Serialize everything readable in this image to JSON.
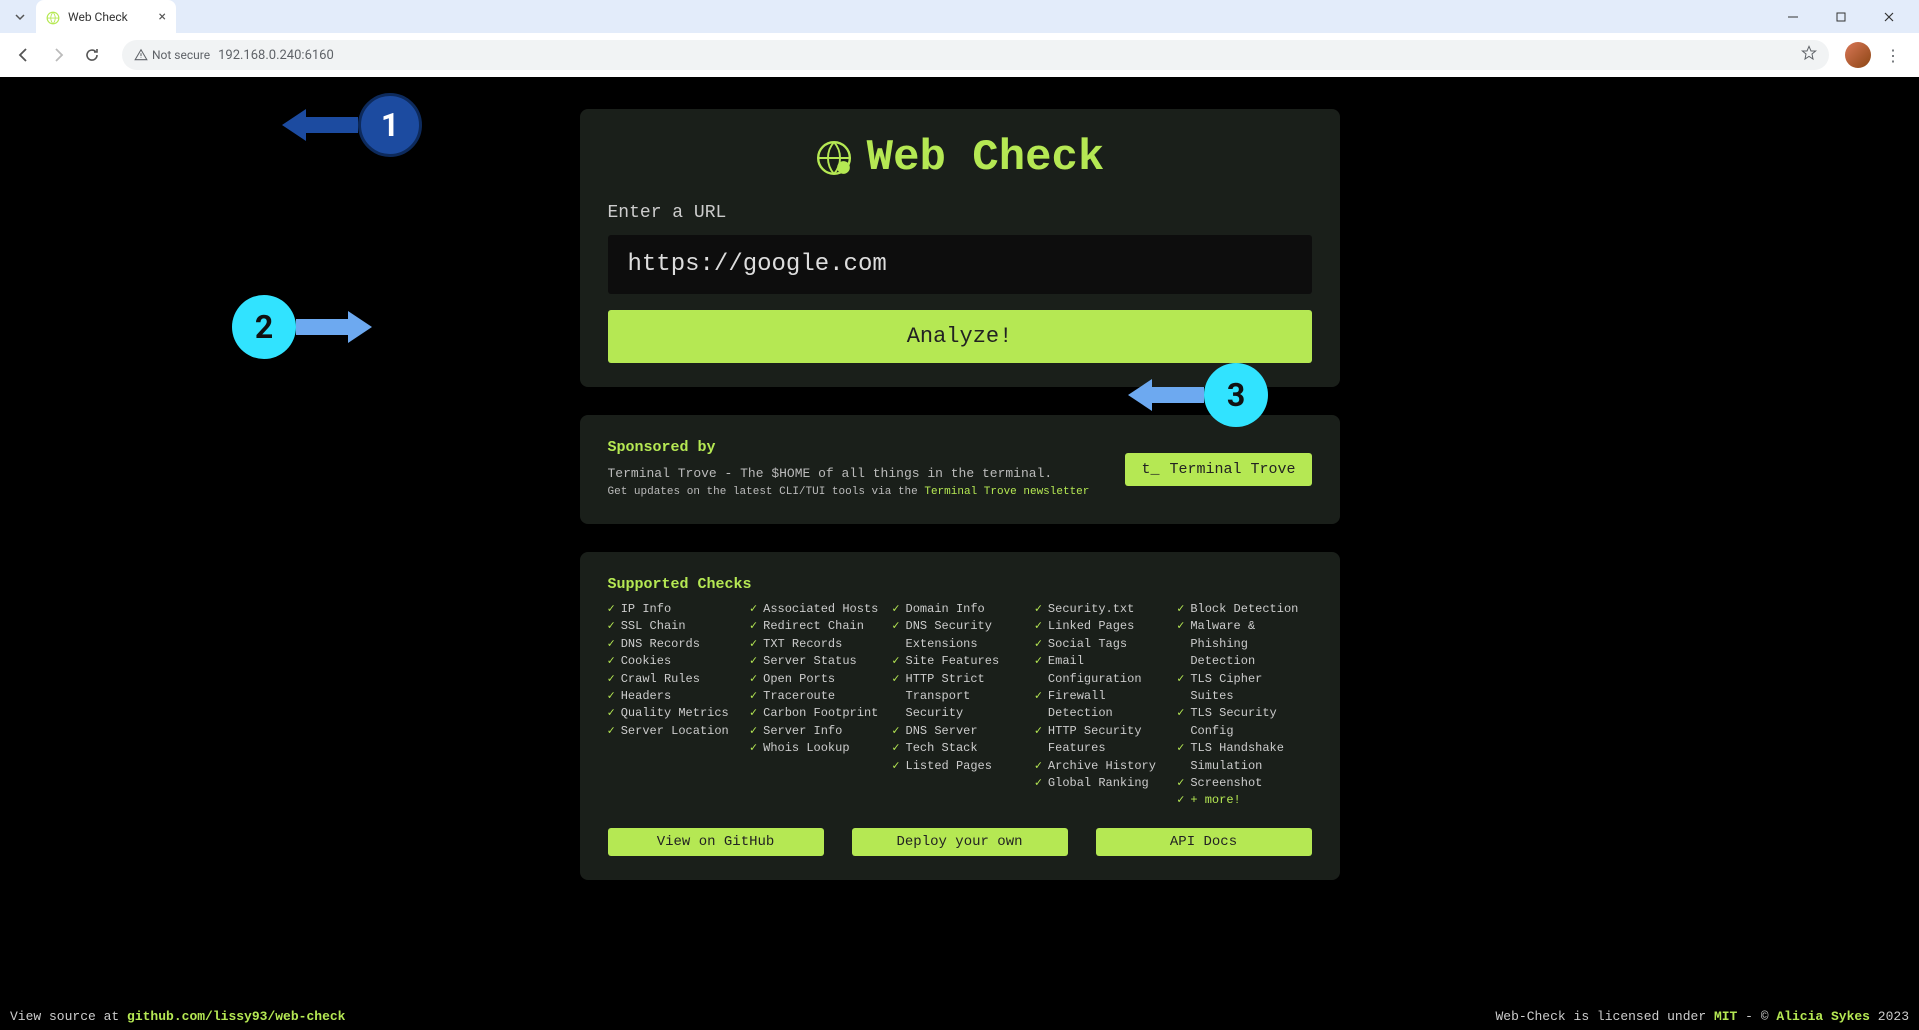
{
  "browser": {
    "tab_title": "Web Check",
    "not_secure_label": "Not secure",
    "url": "192.168.0.240:6160"
  },
  "app": {
    "title": "Web Check",
    "input_label": "Enter a URL",
    "url_value": "https://google.com",
    "analyze_label": "Analyze!"
  },
  "sponsor": {
    "heading": "Sponsored by",
    "line1": "Terminal Trove - The $HOME of all things in the terminal.",
    "line2_pre": "Get updates on the latest CLI/TUI tools via the ",
    "line2_link": "Terminal Trove newsletter",
    "button_prefix": "t_",
    "button_label": "Terminal Trove"
  },
  "checks": {
    "heading": "Supported Checks",
    "cols": [
      [
        "IP Info",
        "SSL Chain",
        "DNS Records",
        "Cookies",
        "Crawl Rules",
        "Headers",
        "Quality Metrics",
        "Server Location"
      ],
      [
        "Associated Hosts",
        "Redirect Chain",
        "TXT Records",
        "Server Status",
        "Open Ports",
        "Traceroute",
        "Carbon Footprint",
        "Server Info",
        "Whois Lookup"
      ],
      [
        "Domain Info",
        "DNS Security Extensions",
        "Site Features",
        "HTTP Strict Transport Security",
        "DNS Server",
        "Tech Stack",
        "Listed Pages"
      ],
      [
        "Security.txt",
        "Linked Pages",
        "Social Tags",
        "Email Configuration",
        "Firewall Detection",
        "HTTP Security Features",
        "Archive History",
        "Global Ranking"
      ],
      [
        "Block Detection",
        "Malware & Phishing Detection",
        "TLS Cipher Suites",
        "TLS Security Config",
        "TLS Handshake Simulation",
        "Screenshot",
        "+ more!"
      ]
    ]
  },
  "buttons": {
    "github": "View on GitHub",
    "deploy": "Deploy your own",
    "api": "API Docs"
  },
  "footer": {
    "left_pre": "View source at ",
    "left_link": "github.com/lissy93/web-check",
    "right_pre": "Web-Check is licensed under ",
    "license": "MIT",
    "right_mid": " - © ",
    "author": "Alicia Sykes",
    "right_post": " 2023"
  },
  "annotations": {
    "a1": "1",
    "a2": "2",
    "a3": "3"
  }
}
